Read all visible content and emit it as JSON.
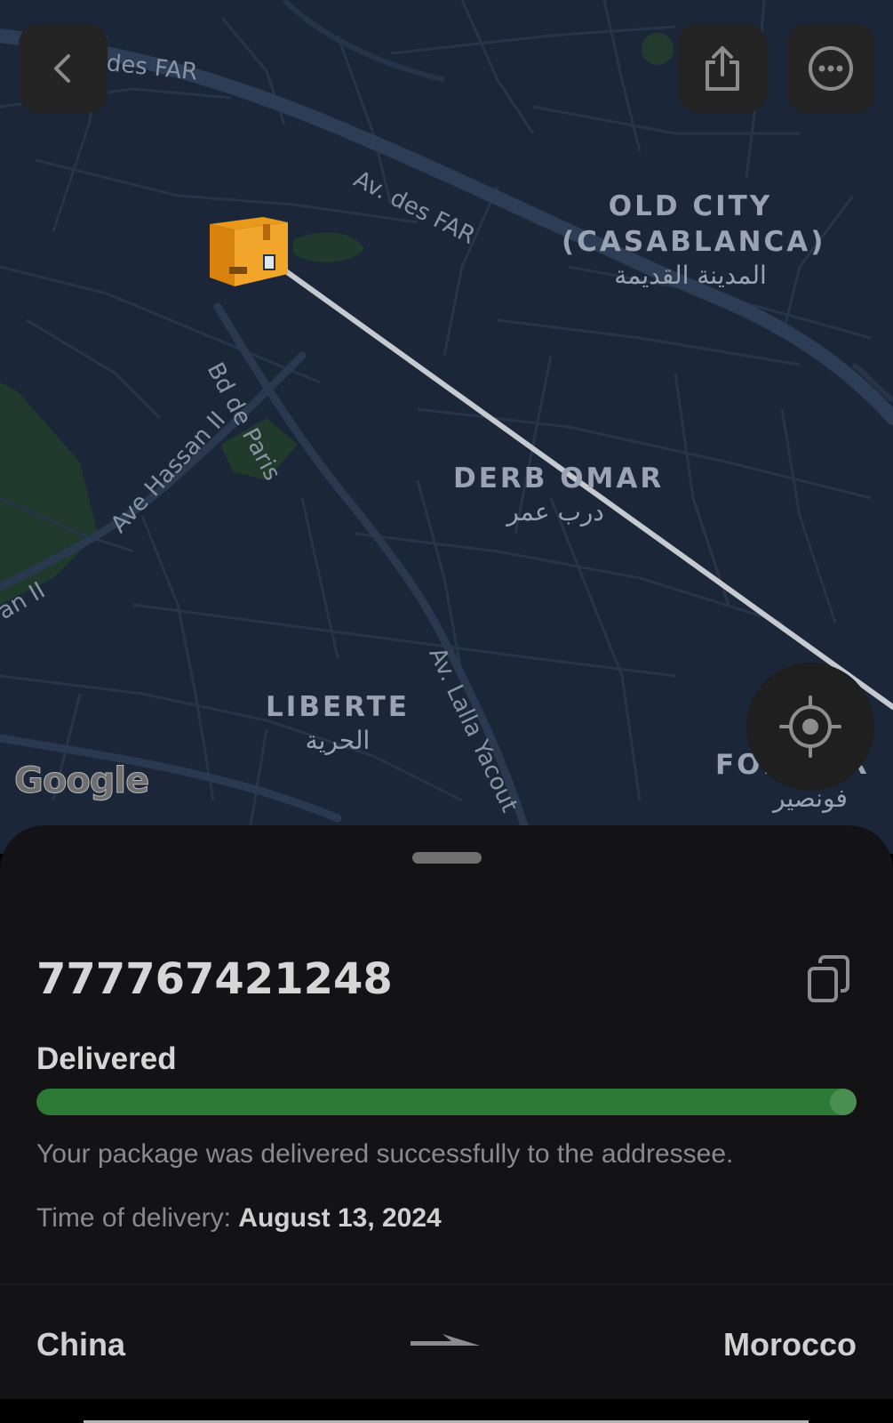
{
  "map": {
    "districts": [
      {
        "name": "OLD CITY\n(CASABLANCA)",
        "arabic": "المدينة القديمة"
      },
      {
        "name": "DERB OMAR",
        "arabic": "درب عمر"
      },
      {
        "name": "LIBERTE",
        "arabic": "الحرية"
      },
      {
        "name": "FONCIER",
        "arabic": "فونصير"
      }
    ],
    "streets": [
      "des FAR",
      "Av. des FAR",
      "Bd de Paris",
      "Ave Hassan II",
      "an II",
      "Av. Lalla Yacout"
    ],
    "attribution": "Google",
    "buttons": {
      "back": "chevron-left-icon",
      "share": "share-icon",
      "more": "more-icon",
      "locate": "locate-icon"
    }
  },
  "shipment": {
    "tracking_number": "777767421248",
    "status": "Delivered",
    "progress": 1.0,
    "description": "Your package was delivered successfully to the addressee.",
    "delivery_time_label": "Time of delivery:",
    "delivery_date": "August 13, 2024",
    "origin": "China",
    "destination": "Morocco"
  },
  "colors": {
    "progress_fill": "#2c7a35",
    "sheet_background": "#131315",
    "map_background": "#1b2638"
  }
}
